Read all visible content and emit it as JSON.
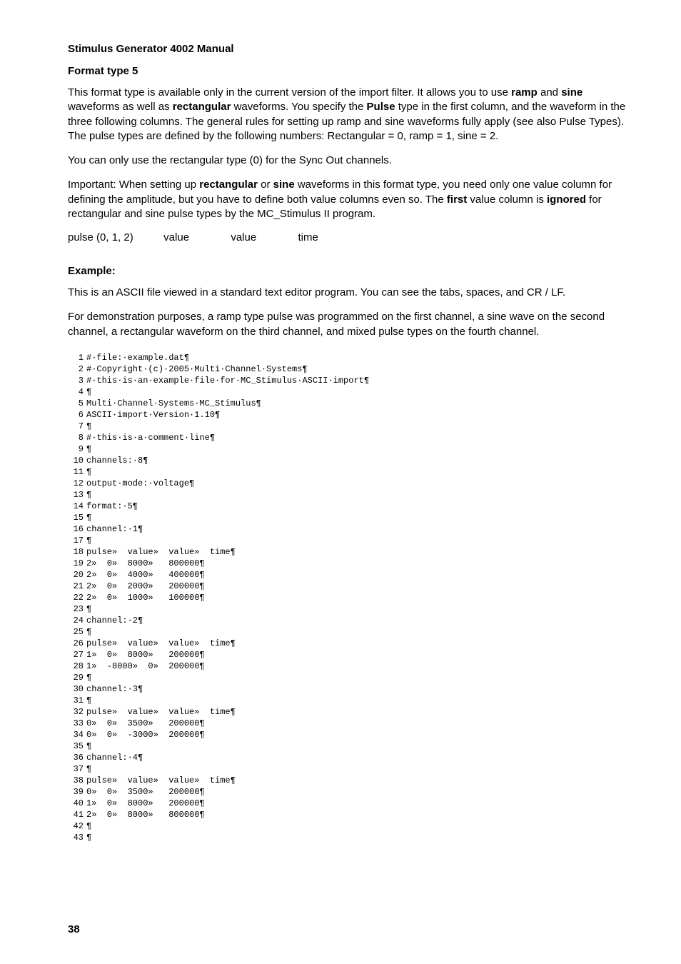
{
  "doc_title": "Stimulus Generator 4002 Manual",
  "section_heading": "Format type 5",
  "paragraphs": {
    "p1_pre": "This format type is available only in the current version of the import filter. It allows you to use ",
    "p1_b1": "ramp",
    "p1_mid1": " and ",
    "p1_b2": "sine",
    "p1_mid2": " waveforms as well as ",
    "p1_b3": "rectangular",
    "p1_mid3": " waveforms. You specify the ",
    "p1_b4": "Pulse",
    "p1_post": " type in the first column, and the waveform in the three following columns. The general rules for setting up ramp and sine waveforms fully apply (see also Pulse Types). The pulse types are defined by the following numbers: Rectangular = 0, ramp = 1, sine = 2.",
    "p2": "You can only use the rectangular type (0) for the Sync Out channels.",
    "p3_pre": "Important: When setting up ",
    "p3_b1": "rectangular",
    "p3_mid1": " or ",
    "p3_b2": "sine",
    "p3_mid2": " waveforms in this format type, you need only one value column for defining the amplitude, but you have to define both value columns even so. The ",
    "p3_b3": "first",
    "p3_mid3": " value column is ",
    "p3_b4": "ignored",
    "p3_post": " for rectangular and sine pulse types by the MC_Stimulus II program."
  },
  "columns": {
    "c0": "pulse (0, 1, 2)",
    "c1": "value",
    "c2": "value",
    "c3": "time"
  },
  "example_heading": "Example:",
  "example_paragraphs": {
    "e1": "This is an ASCII file viewed in a standard text editor program. You can see the tabs, spaces, and CR / LF.",
    "e2": "For demonstration purposes, a ramp type pulse was programmed on the first channel, a sine wave on the second channel, a rectangular waveform on the third channel, and mixed pulse types on the fourth channel."
  },
  "code_lines": [
    "#·file:·example.dat¶",
    "#·Copyright·(c)·2005·Multi·Channel·Systems¶",
    "#·this·is·an·example·file·for·MC_Stimulus·ASCII·import¶",
    "¶",
    "Multi·Channel·Systems·MC_Stimulus¶",
    "ASCII·import·Version·1.10¶",
    "¶",
    "#·this·is·a·comment·line¶",
    "¶",
    "channels:·8¶",
    "¶",
    "output·mode:·voltage¶",
    "¶",
    "format:·5¶",
    "¶",
    "channel:·1¶",
    "¶",
    "pulse»  value»  value»  time¶",
    "2»  0»  8000»   800000¶",
    "2»  0»  4000»   400000¶",
    "2»  0»  2000»   200000¶",
    "2»  0»  1000»   100000¶",
    "¶",
    "channel:·2¶",
    "¶",
    "pulse»  value»  value»  time¶",
    "1»  0»  8000»   200000¶",
    "1»  -8000»  0»  200000¶",
    "¶",
    "channel:·3¶",
    "¶",
    "pulse»  value»  value»  time¶",
    "0»  0»  3500»   200000¶",
    "0»  0»  -3000»  200000¶",
    "¶",
    "channel:·4¶",
    "¶",
    "pulse»  value»  value»  time¶",
    "0»  0»  3500»   200000¶",
    "1»  0»  8000»   200000¶",
    "2»  0»  8000»   800000¶",
    "¶",
    "¶"
  ],
  "page_number": "38"
}
